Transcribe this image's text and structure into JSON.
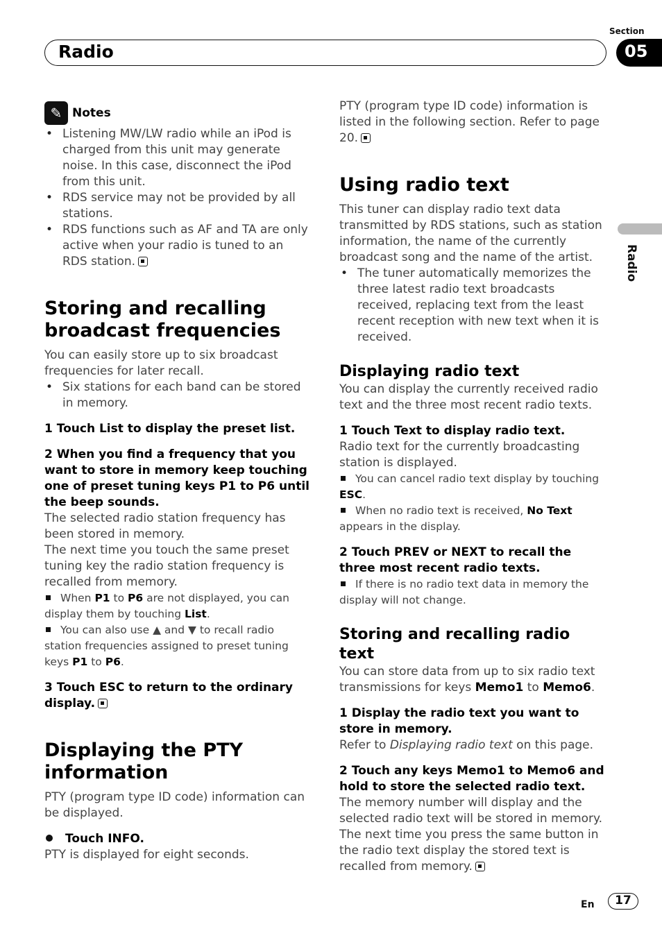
{
  "header": {
    "section_label": "Section",
    "section_number": "05",
    "title": "Radio",
    "side_tab_label": "Radio"
  },
  "left": {
    "notes_title": "Notes",
    "notes": [
      "Listening MW/LW radio while an iPod is charged from this unit may generate noise. In this case, disconnect the iPod from this unit.",
      "RDS service may not be provided by all stations.",
      "RDS functions such as AF and TA are only active when your radio is tuned to an RDS station."
    ],
    "storing": {
      "heading": "Storing and recalling broadcast frequencies",
      "intro": "You can easily store up to six broadcast frequencies for later recall.",
      "bullet": "Six stations for each band can be stored in memory.",
      "step1": "1    Touch List to display the preset list.",
      "step2": "2    When you find a frequency that you want to store in memory keep touching one of preset tuning keys P1 to P6 until the beep sounds.",
      "step2_text1": "The selected radio station frequency has been stored in memory.",
      "step2_text2": "The next time you touch the same preset tuning key the radio station frequency is recalled from memory.",
      "note1_a": "When ",
      "note1_b1": "P1",
      "note1_c": " to ",
      "note1_b2": "P6",
      "note1_d": " are not displayed, you can display them by touching ",
      "note1_b3": "List",
      "note1_e": ".",
      "note2_a": "You can also use ▲ and ▼ to recall radio station frequencies assigned to preset tuning keys ",
      "note2_b1": "P1",
      "note2_c": " to ",
      "note2_b2": "P6",
      "note2_d": ".",
      "step3": "3    Touch ESC to return to the ordinary display."
    },
    "pty": {
      "heading": "Displaying the PTY information",
      "intro": "PTY (program type ID code) information can be displayed.",
      "step": "Touch INFO.",
      "step_text": "PTY is displayed for eight seconds."
    }
  },
  "right": {
    "pty_cont": "PTY (program type ID code) information is listed in the following section. Refer to page 20.",
    "radio_text": {
      "heading": "Using radio text",
      "intro": "This tuner can display radio text data transmitted by RDS stations, such as station information, the name of the currently broadcast song and the name of the artist.",
      "bullet": "The tuner automatically memorizes the three latest radio text broadcasts received, replacing text from the least recent reception with new text when it is received."
    },
    "displaying": {
      "heading": "Displaying radio text",
      "intro": "You can display the currently received radio text and the three most recent radio texts.",
      "step1": "1    Touch Text to display radio text.",
      "step1_text": "Radio text for the currently broadcasting station is displayed.",
      "note1_a": "You can cancel radio text display by touching ",
      "note1_b": "ESC",
      "note1_c": ".",
      "note2_a": "When no radio text is received, ",
      "note2_b": "No Text",
      "note2_c": " appears in the display.",
      "step2": "2    Touch PREV or NEXT to recall the three most recent radio texts.",
      "note3": "If there is no radio text data in memory the display will not change."
    },
    "storing_text": {
      "heading": "Storing and recalling radio text",
      "intro_a": "You can store data from up to six radio text transmissions for keys ",
      "intro_b1": "Memo1",
      "intro_c": " to ",
      "intro_b2": "Memo6",
      "intro_d": ".",
      "step1": "1    Display the radio text you want to store in memory.",
      "step1_a": "Refer to ",
      "step1_i": "Displaying radio text",
      "step1_b": " on this page.",
      "step2": "2    Touch any keys Memo1 to Memo6 and hold to store the selected radio text.",
      "step2_text1": "The memory number will display and the selected radio text will be stored in memory.",
      "step2_text2": "The next time you press the same button in the radio text display the stored text is recalled from memory."
    }
  },
  "footer": {
    "language": "En",
    "page_number": "17"
  }
}
